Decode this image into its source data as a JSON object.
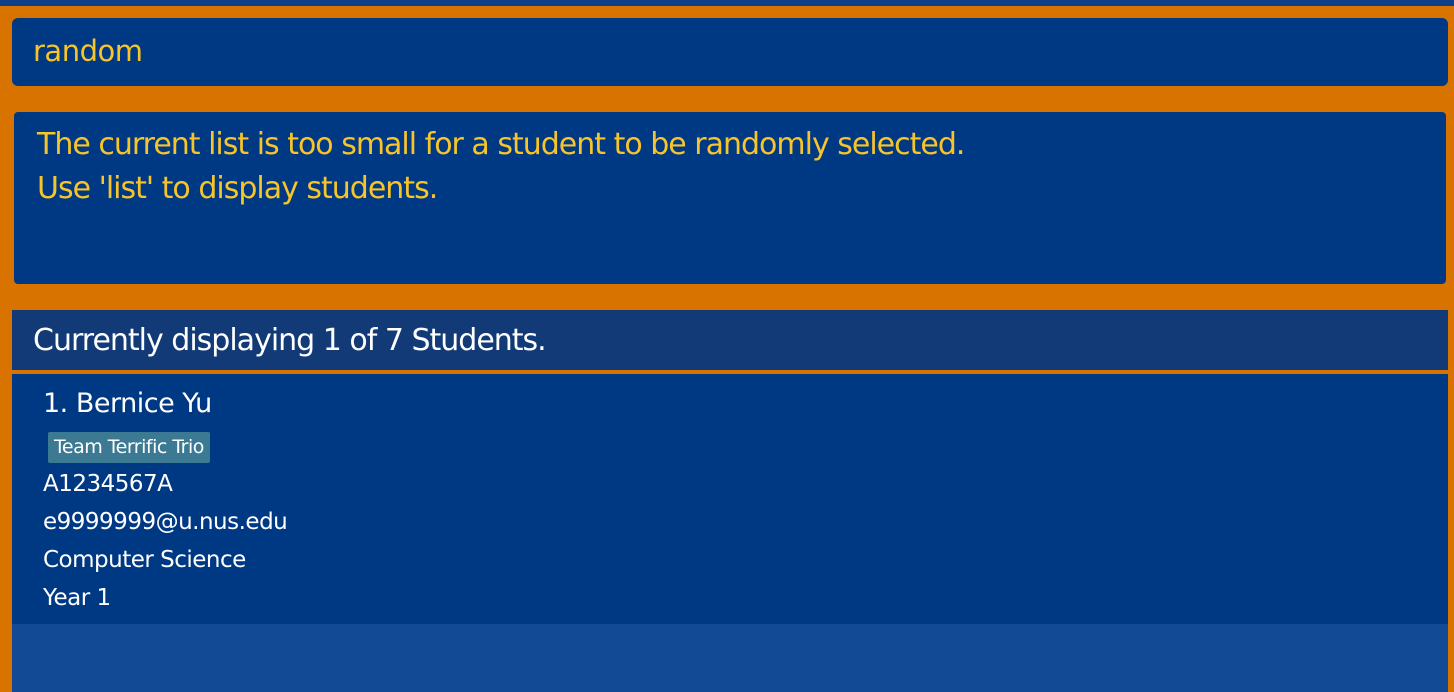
{
  "command": {
    "value": "random"
  },
  "result": {
    "lines": [
      "The current list is too small for a student to be randomly selected.",
      "Use 'list' to display students."
    ]
  },
  "list": {
    "header": "Currently displaying 1 of 7 Students.",
    "students": [
      {
        "index": "1.",
        "name": "Bernice Yu",
        "tags": [
          "Team Terrific Trio"
        ],
        "student_id": "A1234567A",
        "email": "e9999999@u.nus.edu",
        "major": "Computer Science",
        "year": "Year 1"
      }
    ]
  },
  "colors": {
    "background": "#D97300",
    "panel": "#003983",
    "header": "#113A77",
    "command_text": "#F7C42A",
    "tag": "#3C7A93"
  }
}
